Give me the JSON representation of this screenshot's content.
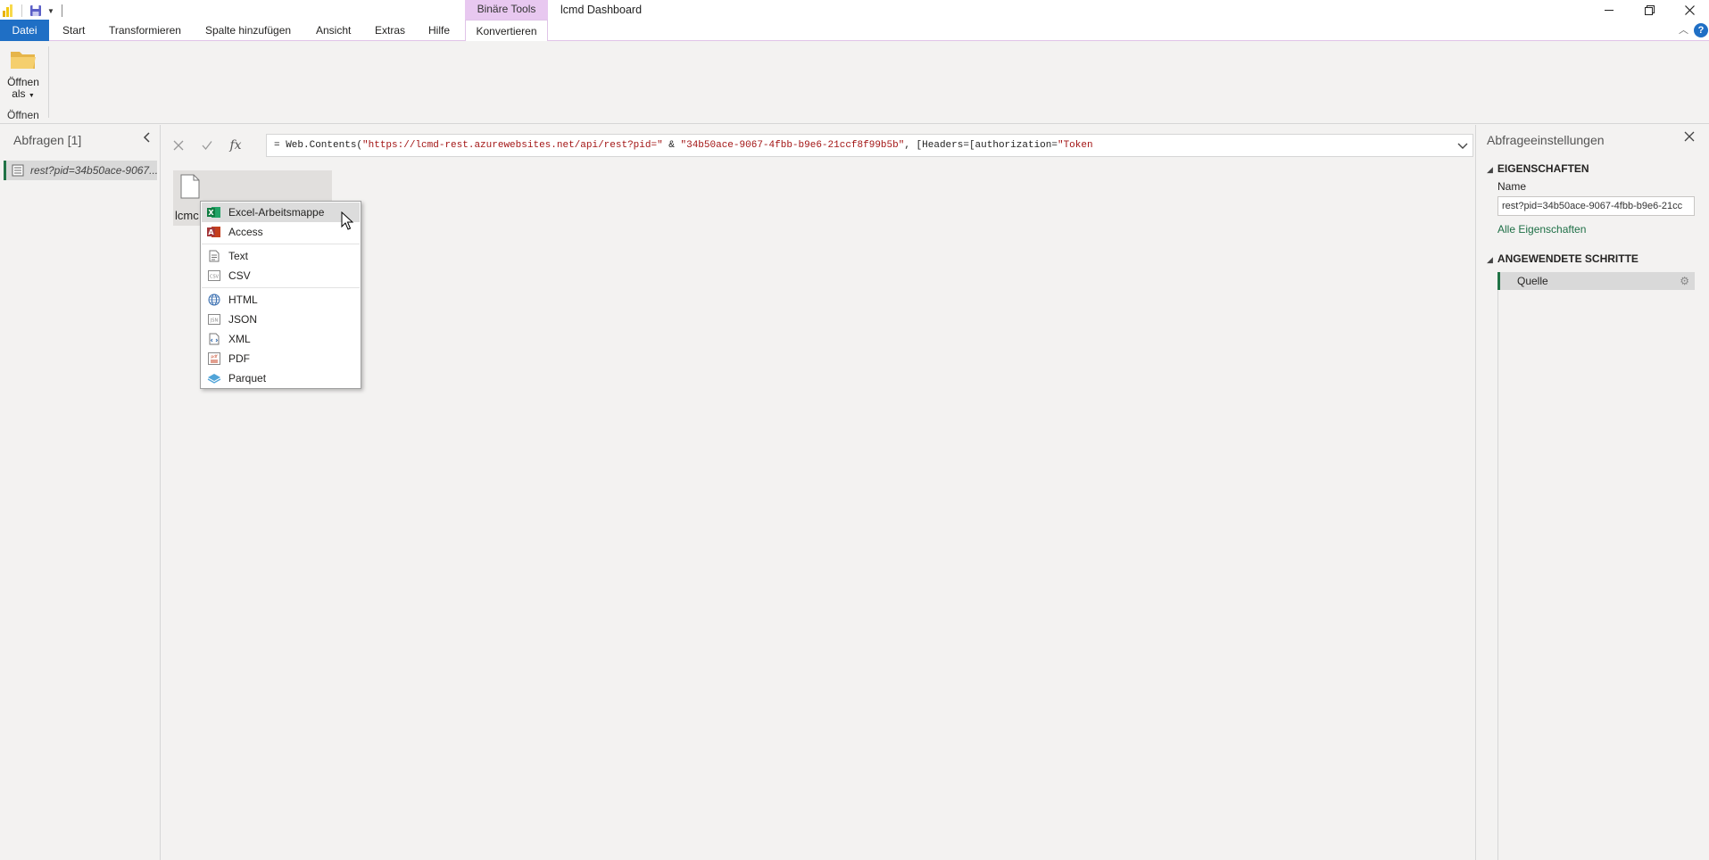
{
  "window": {
    "title": "lcmd Dashboard",
    "context_tab_group": "Binäre Tools"
  },
  "tabs": [
    {
      "label": "Datei"
    },
    {
      "label": "Start"
    },
    {
      "label": "Transformieren"
    },
    {
      "label": "Spalte hinzufügen"
    },
    {
      "label": "Ansicht"
    },
    {
      "label": "Extras"
    },
    {
      "label": "Hilfe"
    },
    {
      "label": "Konvertieren"
    }
  ],
  "ribbon": {
    "open_as_line1": "Öffnen",
    "open_as_line2": "als",
    "group_label": "Öffnen"
  },
  "queries_pane": {
    "title": "Abfragen [1]",
    "items": [
      {
        "label": "rest?pid=34b50ace-9067..."
      }
    ]
  },
  "formula_bar": {
    "prefix": "= Web.Contents(",
    "url": "\"https://lcmd-rest.azurewebsites.net/api/rest?pid=\"",
    "amp": " & ",
    "pid": "\"34b50ace-9067-4fbb-b9e6-21ccf8f99b5b\"",
    "headers": ", [Headers=[authorization=",
    "token": "\"Token"
  },
  "canvas": {
    "file_label": "lcmc"
  },
  "context_menu": {
    "items": [
      {
        "label": "Excel-Arbeitsmappe",
        "icon": "excel-icon"
      },
      {
        "label": "Access",
        "icon": "access-icon"
      },
      {
        "label": "Text",
        "icon": "text-file-icon"
      },
      {
        "label": "CSV",
        "icon": "csv-icon"
      },
      {
        "label": "HTML",
        "icon": "globe-icon"
      },
      {
        "label": "JSON",
        "icon": "json-icon"
      },
      {
        "label": "XML",
        "icon": "xml-icon"
      },
      {
        "label": "PDF",
        "icon": "pdf-icon"
      },
      {
        "label": "Parquet",
        "icon": "parquet-icon"
      }
    ]
  },
  "settings_pane": {
    "title": "Abfrageeinstellungen",
    "properties_header": "EIGENSCHAFTEN",
    "name_label": "Name",
    "name_value": "rest?pid=34b50ace-9067-4fbb-b9e6-21cc",
    "all_properties_link": "Alle Eigenschaften",
    "steps_header": "ANGEWENDETE SCHRITTE",
    "steps": [
      {
        "label": "Quelle"
      }
    ]
  },
  "colors": {
    "file_tab": "#1f6fc5",
    "context_tab": "#e8c8f0",
    "accent_green": "#217346",
    "link_green": "#1e6f46"
  }
}
